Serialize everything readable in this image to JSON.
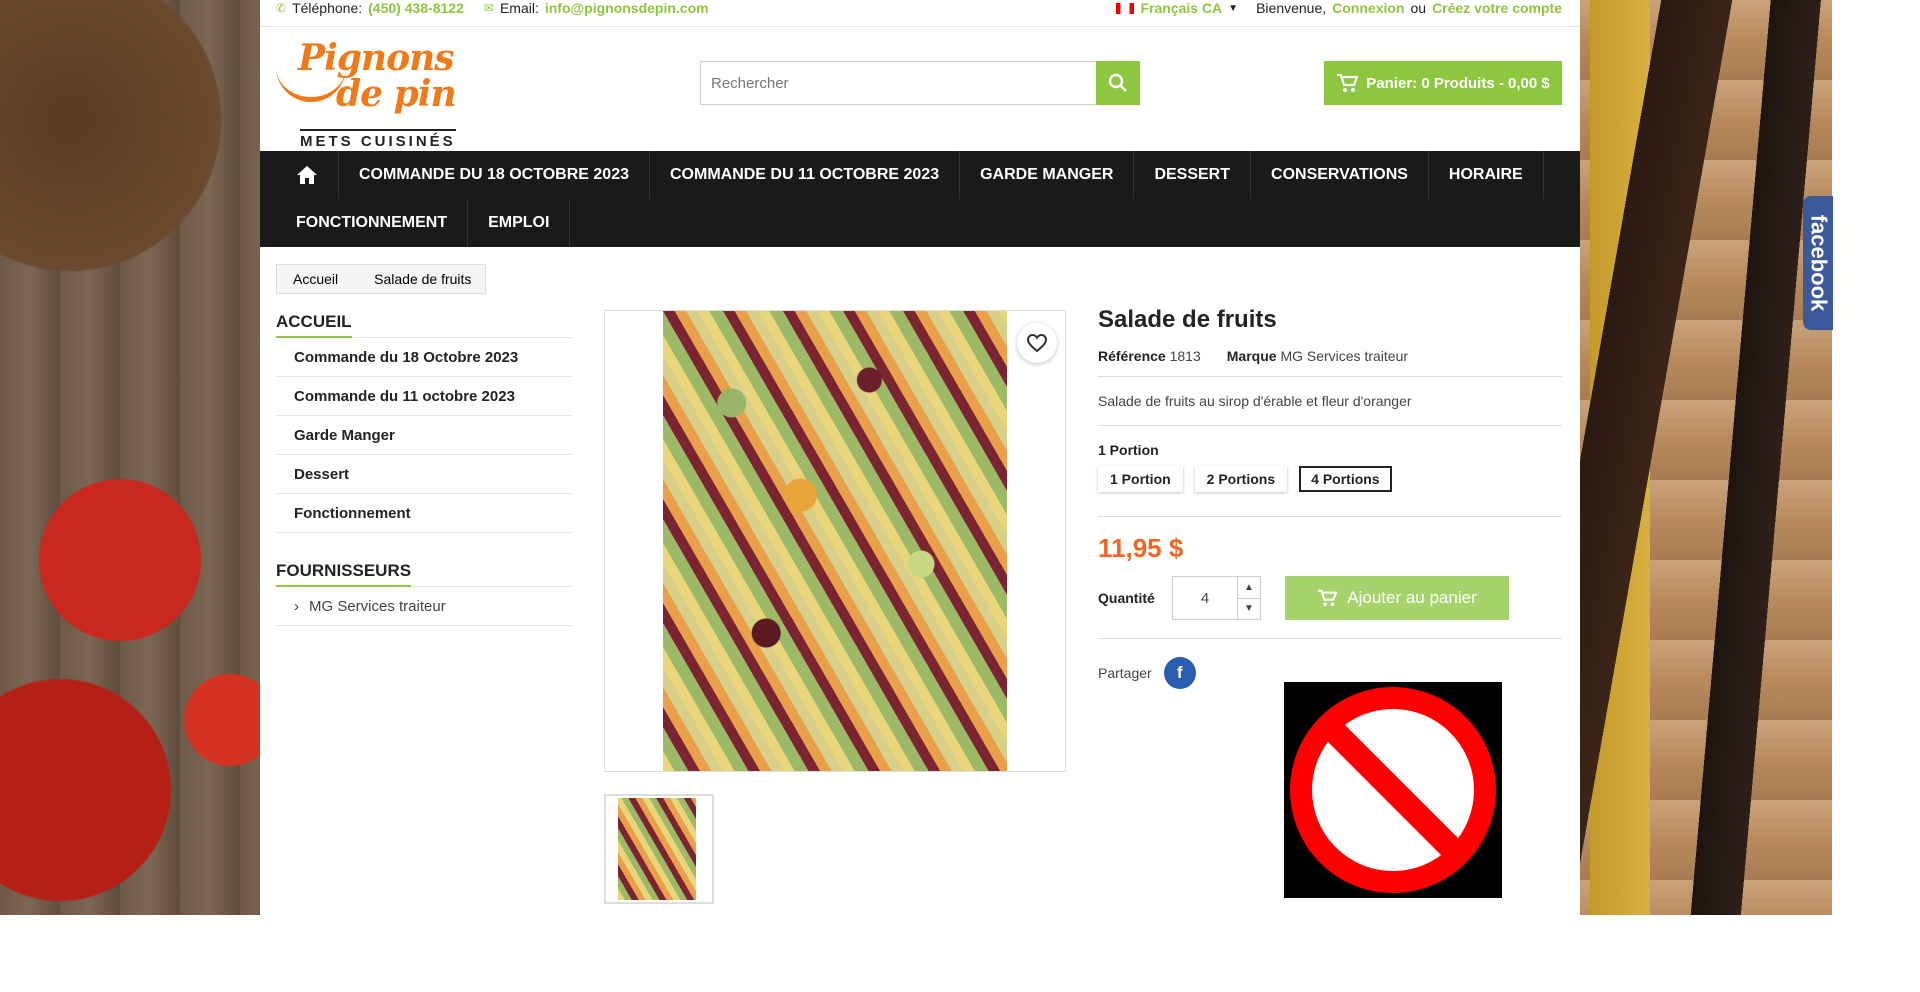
{
  "topbar": {
    "phone_label": "Téléphone:",
    "phone": "(450) 438-8122",
    "email_label": "Email:",
    "email": "info@pignonsdepin.com",
    "language": "Français CA",
    "welcome": "Bienvenue,",
    "login": "Connexion",
    "or": "ou",
    "register": "Créez votre compte"
  },
  "logo": {
    "line1": "Pignons",
    "line2": "de pin",
    "tagline": "METS CUISINÉS"
  },
  "search": {
    "placeholder": "Rechercher"
  },
  "cart": {
    "label": "Panier: 0 Produits - 0,00 $"
  },
  "nav": {
    "row1": [
      "COMMANDE DU 18 OCTOBRE 2023",
      "COMMANDE DU 11 OCTOBRE 2023",
      "GARDE MANGER",
      "DESSERT",
      "CONSERVATIONS",
      "HORAIRE"
    ],
    "row2": [
      "FONCTIONNEMENT",
      "EMPLOI"
    ]
  },
  "breadcrumb": [
    "Accueil",
    "Salade de fruits"
  ],
  "sidebar": {
    "categories_title": "ACCUEIL",
    "categories": [
      "Commande du 18 Octobre 2023",
      "Commande du 11 octobre 2023",
      "Garde Manger",
      "Dessert",
      "Fonctionnement"
    ],
    "suppliers_title": "FOURNISSEURS",
    "suppliers": [
      "MG Services traiteur"
    ]
  },
  "product": {
    "title": "Salade de fruits",
    "reference_label": "Référence",
    "reference": "1813",
    "brand_label": "Marque",
    "brand": "MG Services traiteur",
    "description": "Salade de fruits au sirop d'érable et fleur d'oranger",
    "variant_label": "1 Portion",
    "variants": [
      "1 Portion",
      "2 Portions",
      "4 Portions"
    ],
    "selected_variant": "4 Portions",
    "price": "11,95 $",
    "quantity_label": "Quantité",
    "quantity": "4",
    "add_to_cart": "Ajouter au panier",
    "share_label": "Partager"
  },
  "facebook_tab": "facebook",
  "colors": {
    "accent": "#8dc63f",
    "price": "#f26522",
    "nav_bg": "#1a1a1a",
    "logo": "#f07a1a"
  }
}
